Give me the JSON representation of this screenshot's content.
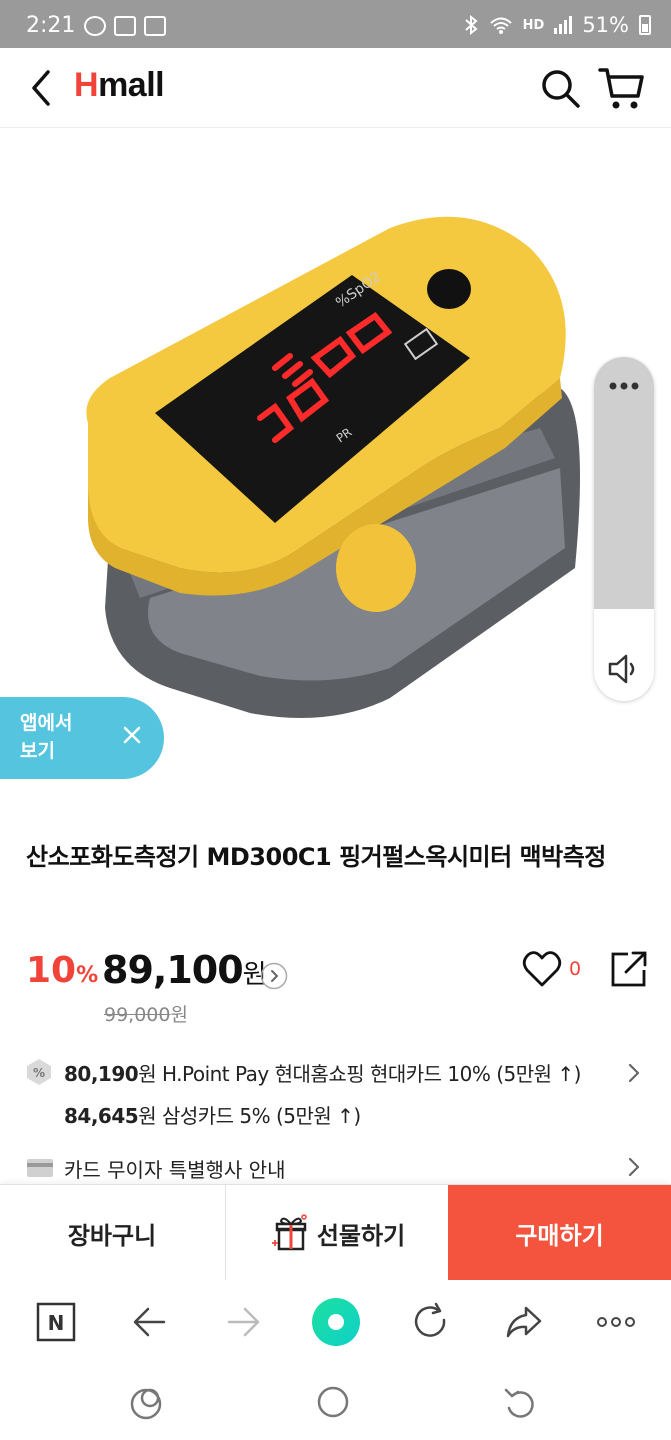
{
  "status_bar": {
    "time": "2:21",
    "battery": "51%",
    "network": "HD"
  },
  "header": {
    "logo_first": "H",
    "logo_rest": "mall"
  },
  "app_banner": {
    "label": "앱에서 보기"
  },
  "product": {
    "title": "산소포화도측정기 MD300C1 핑거펄스옥시미터 맥박측정",
    "discount_value": "10",
    "discount_unit": "%",
    "price": "89,100",
    "price_unit": "원",
    "original_price": "99,000",
    "original_unit": "원",
    "like_count": "0"
  },
  "benefits": {
    "line1_amount": "80,190",
    "line1_text": "원 H.Point Pay 현대홈쇼핑 현대카드 10% (5만원 ↑)",
    "line2_amount": "84,645",
    "line2_text": "원 삼성카드 5% (5만원 ↑)",
    "card_info": "카드 무이자 특별행사 안내"
  },
  "actions": {
    "cart": "장바구니",
    "gift": "선물하기",
    "buy": "구매하기"
  },
  "colors": {
    "brand_red": "#f0443a",
    "buy_button": "#f4533e",
    "banner": "#55c4df",
    "browser_accent": "#1de0a0"
  }
}
